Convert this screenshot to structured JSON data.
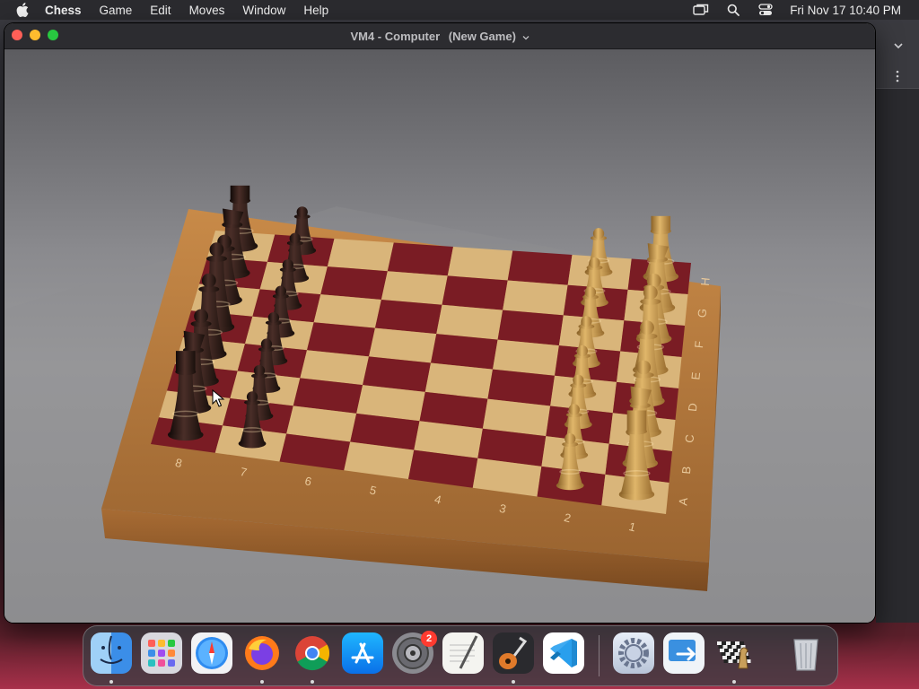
{
  "menubar": {
    "apple_icon": "apple-icon",
    "items": [
      "Chess",
      "Game",
      "Edit",
      "Moves",
      "Window",
      "Help"
    ],
    "datetime": "Fri Nov 17  10:40 PM",
    "status_icons": [
      "screen-mirroring-icon",
      "search-icon",
      "control-center-icon"
    ]
  },
  "window": {
    "title": "VM4 - Computer",
    "subtitle": "(New Game)",
    "controls": [
      "close",
      "minimize",
      "zoom"
    ]
  },
  "board": {
    "files": [
      "8",
      "7",
      "6",
      "5",
      "4",
      "3",
      "2",
      "1"
    ],
    "ranks": [
      "A",
      "B",
      "C",
      "D",
      "E",
      "F",
      "G",
      "H"
    ],
    "colors": {
      "dark_square": "#7a1c24",
      "light_square": "#d9b57a",
      "frame": "#b0783c",
      "white_pieces": "#c9a05a",
      "black_pieces": "#2a1a18"
    }
  },
  "dock": {
    "items": [
      {
        "name": "Finder",
        "icon": "finder-icon",
        "running": true
      },
      {
        "name": "Launchpad",
        "icon": "launchpad-icon",
        "running": false
      },
      {
        "name": "Safari",
        "icon": "safari-icon",
        "running": false
      },
      {
        "name": "Firefox",
        "icon": "firefox-icon",
        "running": true
      },
      {
        "name": "Chrome",
        "icon": "chrome-icon",
        "running": true
      },
      {
        "name": "App Store",
        "icon": "app-store-icon",
        "running": false
      },
      {
        "name": "System Preferences",
        "icon": "system-preferences-icon",
        "running": false,
        "badge": "2"
      },
      {
        "name": "TextEdit",
        "icon": "textedit-icon",
        "running": false
      },
      {
        "name": "GarageBand",
        "icon": "garageband-icon",
        "running": true
      },
      {
        "name": "Visual Studio Code",
        "icon": "vscode-icon",
        "running": false
      },
      {
        "name": "Settings",
        "icon": "settings-gear-icon",
        "running": false
      },
      {
        "name": "Migration",
        "icon": "migration-icon",
        "running": false
      },
      {
        "name": "Chess",
        "icon": "chess-icon",
        "running": true
      },
      {
        "name": "Trash",
        "icon": "trash-icon",
        "running": false
      }
    ]
  }
}
